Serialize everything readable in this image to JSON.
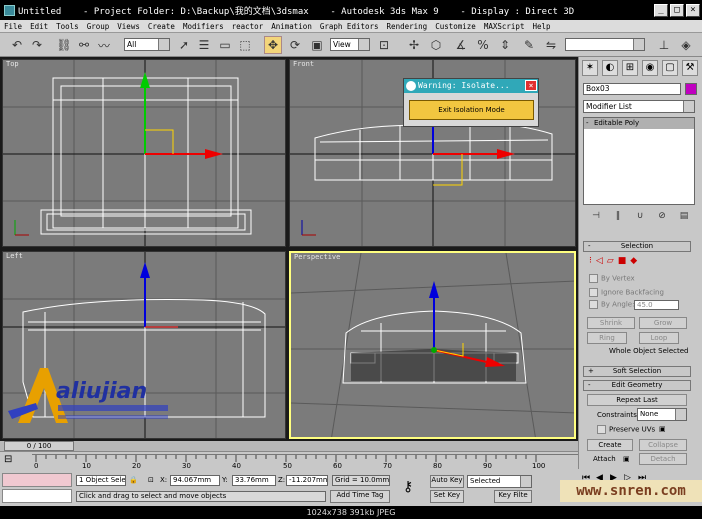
{
  "window": {
    "title": "Untitled    - Project Folder: D:\\Backup\\我的文档\\3dsmax    - Autodesk 3ds Max 9    - Display : Direct 3D",
    "minimize": "_",
    "maximize": "□",
    "close": "×"
  },
  "menu": [
    "File",
    "Edit",
    "Tools",
    "Group",
    "Views",
    "Create",
    "Modifiers",
    "reactor",
    "Animation",
    "Graph Editors",
    "Rendering",
    "Customize",
    "MAXScript",
    "Help"
  ],
  "toolbar": {
    "selection_filter": "All",
    "ref_coord": "View",
    "named_selection": ""
  },
  "viewports": {
    "top": "Top",
    "front": "Front",
    "left": "Left",
    "perspective": "Perspective"
  },
  "warning": {
    "title": "Warning: Isolate...",
    "button": "Exit Isolation Mode"
  },
  "command_panel": {
    "object_name": "Box03",
    "modifier_list": "Modifier List",
    "stack_item": "Editable Poly",
    "selection_rollout": "Selection",
    "by_vertex": "By Vertex",
    "ignore_backfacing": "Ignore Backfacing",
    "by_angle": "By Angle:",
    "angle_value": "45.0",
    "shrink": "Shrink",
    "grow": "Grow",
    "ring": "Ring",
    "loop": "Loop",
    "whole_object": "Whole Object Selected",
    "soft_selection": "Soft Selection",
    "edit_geometry": "Edit Geometry",
    "repeat_last": "Repeat Last",
    "constraints": "Constraints:",
    "constraints_value": "None",
    "preserve_uvs": "Preserve UVs",
    "create": "Create",
    "collapse": "Collapse",
    "attach": "Attach",
    "detach": "Detach",
    "collapse_minus": "-",
    "expand_plus": "+"
  },
  "timeline": {
    "slider": "0 / 100",
    "ticks": [
      "0",
      "10",
      "20",
      "30",
      "40",
      "50",
      "60",
      "70",
      "80",
      "90",
      "100"
    ]
  },
  "status": {
    "selected_count": "1 Object Sele",
    "x_label": "X:",
    "x": "94.067mm",
    "y_label": "Y:",
    "y": "33.76mm",
    "z_label": "Z:",
    "z": "-11.207mm",
    "grid": "Grid = 10.0mm",
    "prompt": "Click and drag to select and move objects",
    "add_time_tag": "Add Time Tag",
    "auto_key": "Auto Key",
    "set_key": "Set Key",
    "key_mode": "Selected",
    "key_filters": "Key Filte"
  },
  "watermark": {
    "logo_text": "aliujian",
    "site": "www.snren.com"
  },
  "image_info": "1024x738  391kb  JPEG",
  "colors": {
    "titlebar": "#000000",
    "viewport_bg": "#7b7b7b",
    "active_border": "#ffff80",
    "warning_title": "#30a8b8",
    "exit_button": "#f2c640"
  }
}
